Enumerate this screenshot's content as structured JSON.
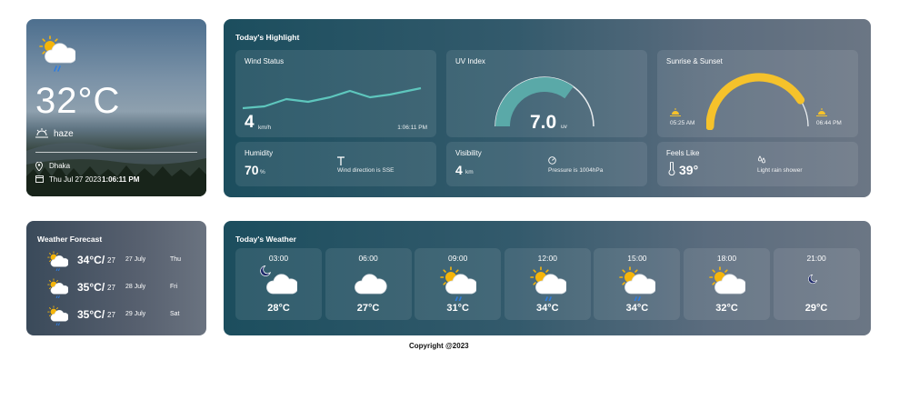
{
  "current": {
    "temperature": "32°C",
    "condition": "haze",
    "location": "Dhaka",
    "date": "Thu Jul 27 2023",
    "time": "1:06:11 PM"
  },
  "highlight": {
    "title": "Today's Highlight",
    "wind": {
      "title": "Wind Status",
      "value": "4",
      "unit": "km/h",
      "time": "1:06:11 PM"
    },
    "uv": {
      "title": "UV Index",
      "value": "7.0",
      "unit": "uv"
    },
    "sun": {
      "title": "Sunrise & Sunset",
      "sunrise": "05:25 AM",
      "sunset": "06:44 PM"
    },
    "humidity": {
      "title": "Humidity",
      "value": "70",
      "unit": "%",
      "note": "Wind direction is SSE"
    },
    "visibility": {
      "title": "Visibility",
      "value": "4",
      "unit": "km",
      "note": "Pressure is 1004hPa"
    },
    "feels": {
      "title": "Feels Like",
      "value": "39°",
      "note": "Light rain shower"
    }
  },
  "forecast": {
    "title": "Weather Forecast",
    "days": [
      {
        "temp": "34°C/",
        "low": "27",
        "date": "27 July",
        "day": "Thu",
        "icon": "sun-cloud-rain-icon"
      },
      {
        "temp": "35°C/",
        "low": "27",
        "date": "28 July",
        "day": "Fri",
        "icon": "sun-cloud-rain-icon"
      },
      {
        "temp": "35°C/",
        "low": "27",
        "date": "29 July",
        "day": "Sat",
        "icon": "sun-cloud-rain-icon"
      }
    ]
  },
  "today": {
    "title": "Today's Weather",
    "hours": [
      {
        "time": "03:00",
        "temp": "28°C",
        "icon": "moon-cloud-icon"
      },
      {
        "time": "06:00",
        "temp": "27°C",
        "icon": "cloud-icon"
      },
      {
        "time": "09:00",
        "temp": "31°C",
        "icon": "sun-cloud-rain-icon"
      },
      {
        "time": "12:00",
        "temp": "34°C",
        "icon": "sun-cloud-rain-icon"
      },
      {
        "time": "15:00",
        "temp": "34°C",
        "icon": "sun-cloud-rain-icon"
      },
      {
        "time": "18:00",
        "temp": "32°C",
        "icon": "sun-cloud-icon"
      },
      {
        "time": "21:00",
        "temp": "29°C",
        "icon": "moon-icon"
      }
    ]
  },
  "footer": {
    "copyright": "Copyright @2023"
  },
  "colors": {
    "accent_teal": "#5aa9a8",
    "sun_yellow": "#f5c22b"
  },
  "metrics": {
    "uv_fraction": 0.7,
    "sun_progress_fraction": 0.82
  }
}
